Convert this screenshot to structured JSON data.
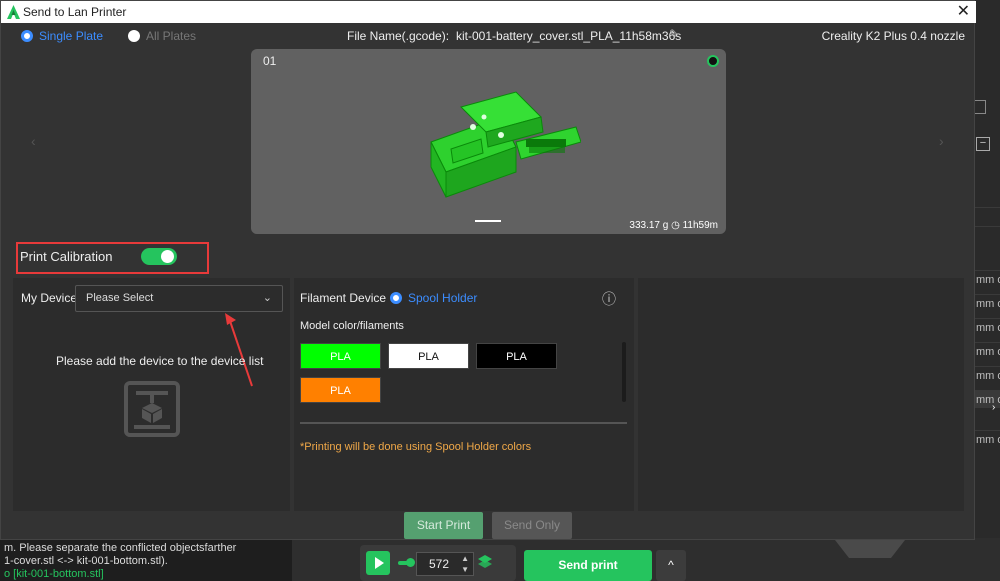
{
  "dialog": {
    "title": "Send to Lan Printer",
    "close_label": "✕",
    "plate_tabs": {
      "single_label": "Single Plate",
      "all_label": "All Plates"
    },
    "file_name_label": "File Name(.gcode):",
    "file_name_value": "kit-001-battery_cover.stl_PLA_11h58m36s",
    "edit_icon": "✎",
    "printer_label": "Creality K2 Plus 0.4 nozzle",
    "preview": {
      "plate_number": "01",
      "stats": "333.17 g ◷ 11h59m",
      "left_arrow": "‹",
      "right_arrow": "›"
    },
    "calibration": {
      "label": "Print Calibration",
      "enabled": true
    },
    "device": {
      "label": "My Device",
      "select_placeholder": "Please Select",
      "empty_message": "Please add the device to the device list"
    },
    "filament": {
      "device_label": "Filament Device",
      "spool_holder_label": "Spool Holder",
      "model_colors_label": "Model color/filaments",
      "chips": [
        {
          "label": "PLA",
          "bg": "#00ff00",
          "fg": "#ffffff"
        },
        {
          "label": "PLA",
          "bg": "#ffffff",
          "fg": "#111111"
        },
        {
          "label": "PLA",
          "bg": "#000000",
          "fg": "#ffffff"
        },
        {
          "label": "PLA",
          "bg": "#ff8000",
          "fg": "#ffffff"
        }
      ],
      "note": "*Printing will be done using Spool Holder colors",
      "info_icon": "ⓘ"
    },
    "actions": {
      "start_print_label": "Start Print",
      "send_only_label": "Send Only"
    }
  },
  "background": {
    "console_lines": [
      "m. Please separate the conflicted objectsfarther",
      "1-cover.stl <-> kit-001-bottom.stl).",
      "o [kit-001-bottom.stl]"
    ],
    "layer_value": "572",
    "send_print_label": "Send print",
    "up_label": "^",
    "right_rows": [
      "mm o",
      "mm o",
      "mm o",
      "mm o",
      "mm o",
      "mm o",
      "mm o"
    ],
    "accent_color": "#25c45e"
  }
}
